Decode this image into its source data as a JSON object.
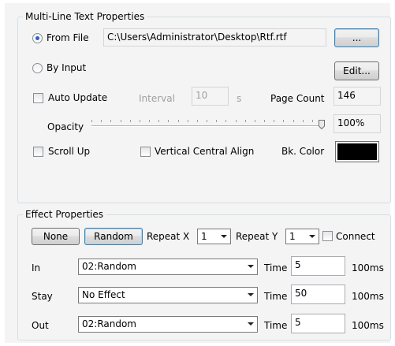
{
  "multiline": {
    "title": "Multi-Line Text Properties",
    "from_file_label": "From File",
    "file_path": "C:\\Users\\Administrator\\Desktop\\Rtf.rtf",
    "browse_label": "...",
    "by_input_label": "By Input",
    "edit_label": "Edit...",
    "auto_update_label": "Auto Update",
    "interval_label": "Interval",
    "interval_value": "10",
    "interval_unit": "s",
    "page_count_label": "Page Count",
    "page_count_value": "146",
    "opacity_label": "Opacity",
    "opacity_value": "100%",
    "opacity_fraction": 1.0,
    "scroll_up_label": "Scroll Up",
    "vertical_align_label": "Vertical Central Align",
    "bk_color_label": "Bk. Color",
    "bk_color": "#000000"
  },
  "effect": {
    "title": "Effect Properties",
    "none_label": "None",
    "random_label": "Random",
    "repeat_x_label": "Repeat X",
    "repeat_x_value": "1",
    "repeat_y_label": "Repeat Y",
    "repeat_y_value": "1",
    "connect_label": "Connect",
    "time_label": "Time",
    "unit_label": "100ms",
    "rows": [
      {
        "label": "In",
        "effect": "02:Random",
        "time": "5"
      },
      {
        "label": "Stay",
        "effect": "No Effect",
        "time": "50"
      },
      {
        "label": "Out",
        "effect": "02:Random",
        "time": "5"
      }
    ]
  }
}
